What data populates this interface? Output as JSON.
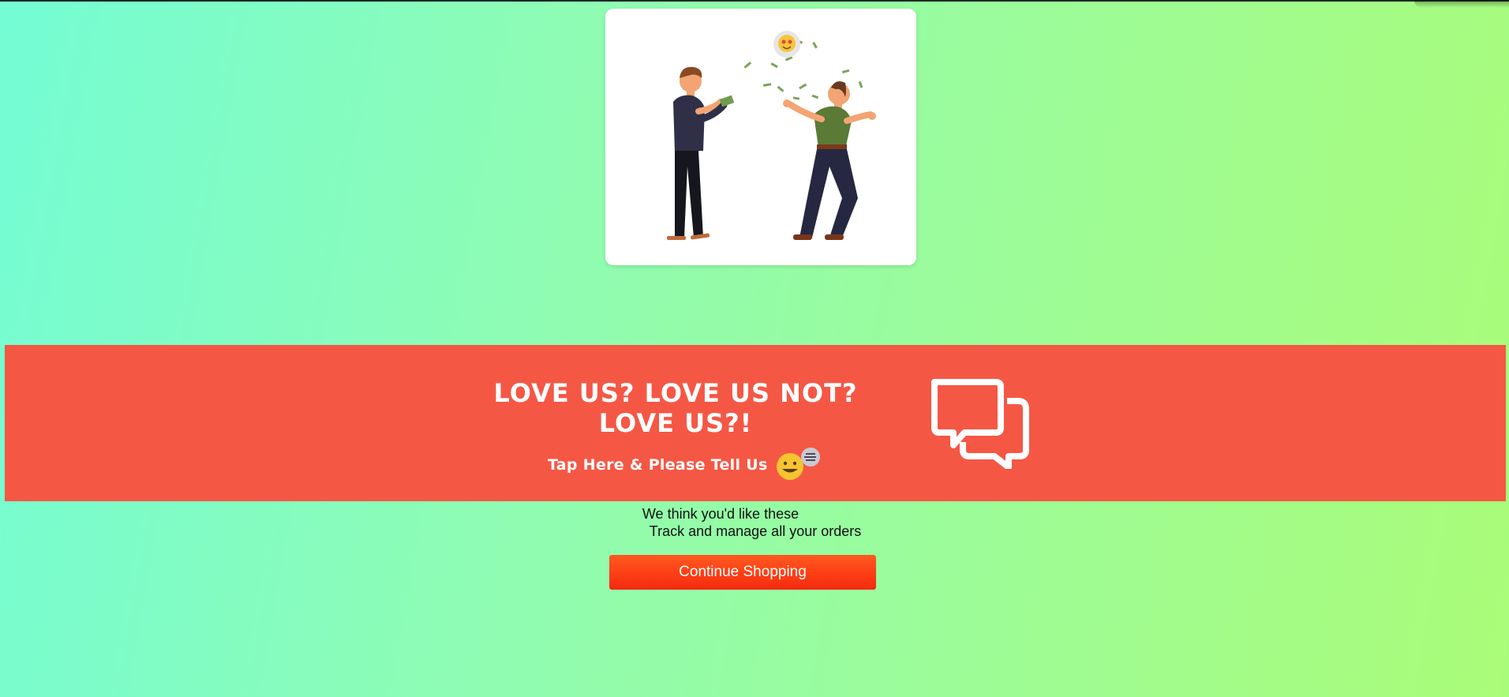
{
  "banner": {
    "headline_line1": "LOVE US? LOVE US NOT?",
    "headline_line2": "LOVE US?!",
    "subtext": "Tap Here & Please Tell Us",
    "background_color": "#f55745",
    "icons": [
      "smiley-icon",
      "speech-bubble-icon",
      "chat-bubbles-icon"
    ]
  },
  "suggestions": {
    "line1": "We think you'd like these",
    "line2": "Track and manage all your orders"
  },
  "actions": {
    "continue_label": "Continue Shopping",
    "continue_color": "#f73a14"
  },
  "illustration": {
    "description_icon": "celebrating-people-illustration"
  }
}
